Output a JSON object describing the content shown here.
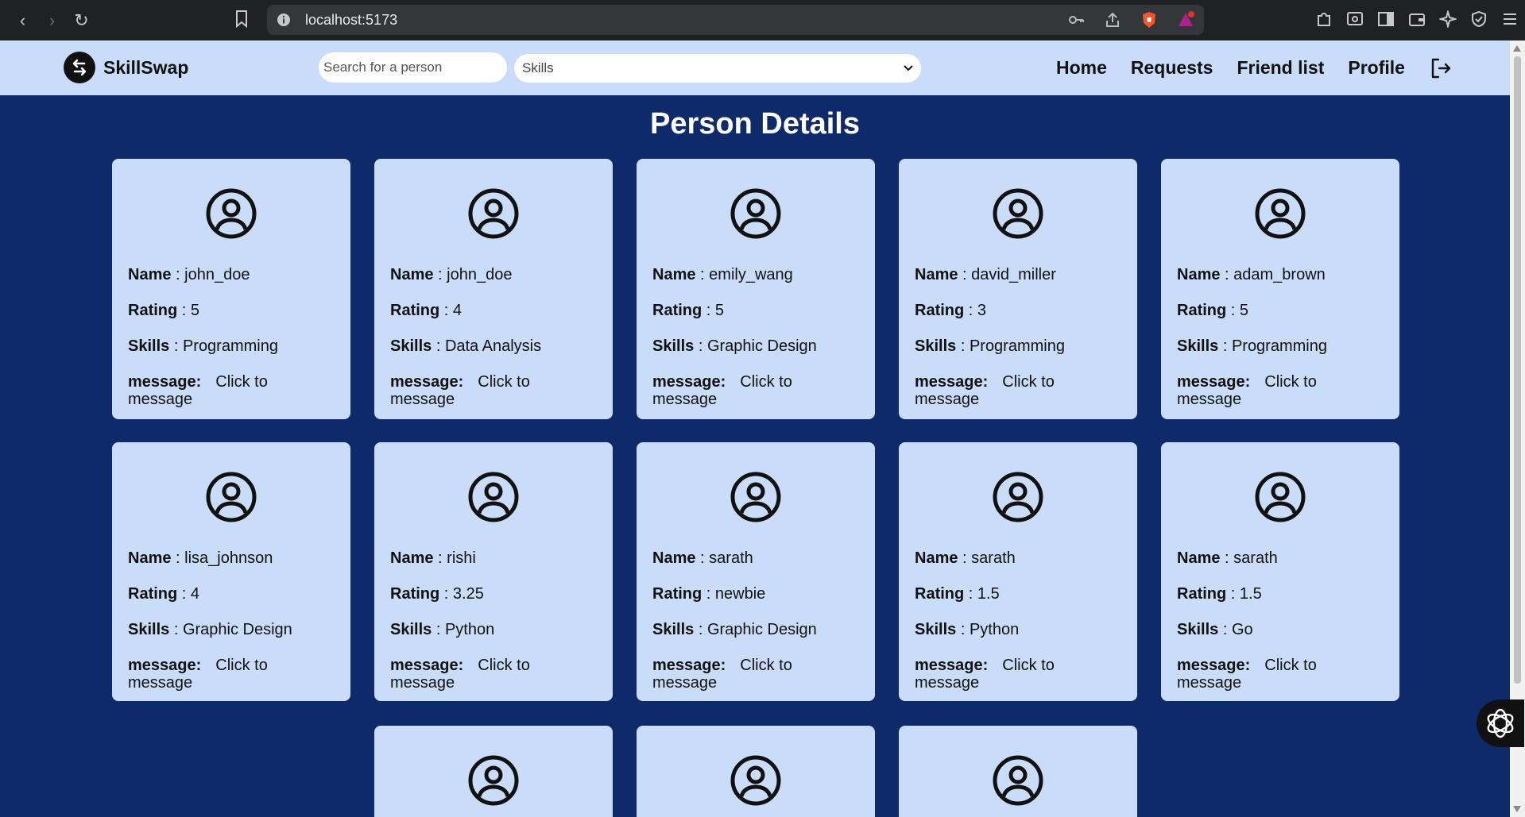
{
  "browser": {
    "url": "localhost:5173",
    "nav": {
      "back": "‹",
      "forward": "›",
      "reload": "↻"
    }
  },
  "app": {
    "brand": "SkillSwap",
    "search": {
      "placeholder": "Search for a person"
    },
    "skills_filter": {
      "selected": "Skills"
    },
    "nav": [
      "Home",
      "Requests",
      "Friend list",
      "Profile"
    ]
  },
  "page": {
    "title": "Person Details",
    "labels": {
      "name": "Name",
      "rating": "Rating",
      "skills": "Skills",
      "message": "message:",
      "sep": " : "
    },
    "people": [
      {
        "name": "john_doe",
        "rating": "5",
        "skills": "Programming",
        "message": "Click to message"
      },
      {
        "name": "john_doe",
        "rating": "4",
        "skills": "Data Analysis",
        "message": "Click to message"
      },
      {
        "name": "emily_wang",
        "rating": "5",
        "skills": "Graphic Design",
        "message": "Click to message"
      },
      {
        "name": "david_miller",
        "rating": "3",
        "skills": "Programming",
        "message": "Click to message"
      },
      {
        "name": "adam_brown",
        "rating": "5",
        "skills": "Programming",
        "message": "Click to message"
      },
      {
        "name": "lisa_johnson",
        "rating": "4",
        "skills": "Graphic Design",
        "message": "Click to message"
      },
      {
        "name": "rishi",
        "rating": "3.25",
        "skills": "Python",
        "message": "Click to message"
      },
      {
        "name": "sarath",
        "rating": "newbie",
        "skills": "Graphic Design",
        "message": "Click to message"
      },
      {
        "name": "sarath",
        "rating": "1.5",
        "skills": "Python",
        "message": "Click to message"
      },
      {
        "name": "sarath",
        "rating": "1.5",
        "skills": "Go",
        "message": "Click to message"
      }
    ],
    "partial_cards": 3
  }
}
